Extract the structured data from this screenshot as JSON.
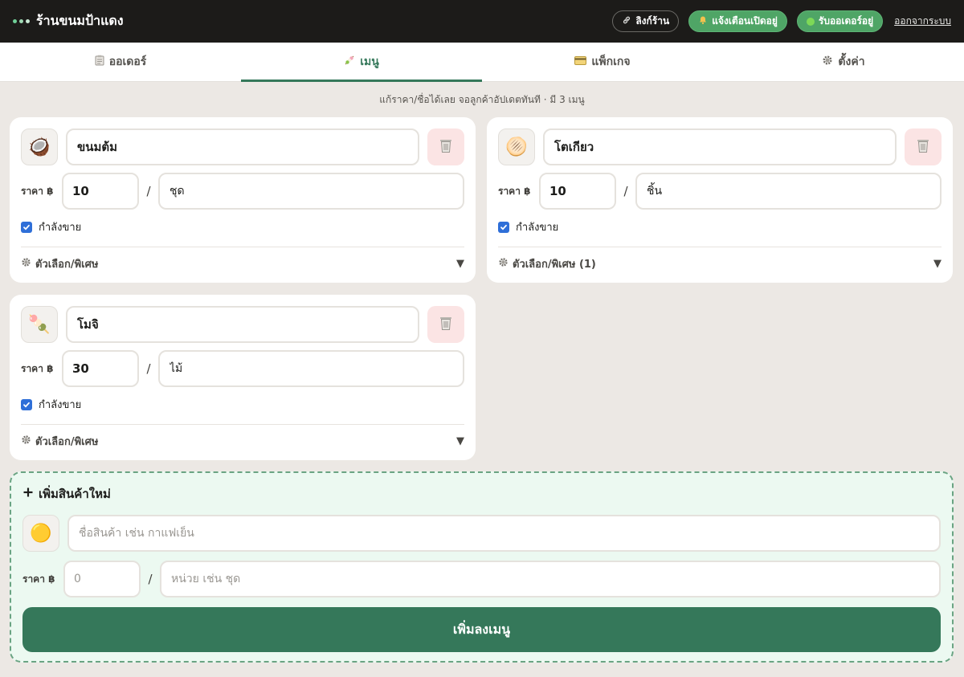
{
  "header": {
    "title": "ร้านขนมป้าแดง",
    "shop_link_label": "ลิงก์ร้าน",
    "notify_label": "แจ้งเตือนเปิดอยู่",
    "accepting_label": "รับออเดอร์อยู่",
    "logout_label": "ออกจากระบบ"
  },
  "tabs": [
    {
      "label": "ออเดอร์",
      "icon": "clipboard-icon"
    },
    {
      "label": "เมนู",
      "icon": "dango-icon"
    },
    {
      "label": "แพ็กเกจ",
      "icon": "card-icon"
    },
    {
      "label": "ตั้งค่า",
      "icon": "gear-icon"
    }
  ],
  "active_tab": 1,
  "subtitle": "แก้ราคา/ชื่อได้เลย จอลูกค้าอัปเดตทันที · มี 3 เมนู",
  "price_label": "ราคา ฿",
  "menu": [
    {
      "emoji": "🥥",
      "icon": "coconut-icon",
      "name": "ขนมต้ม",
      "price": "10",
      "unit": "ชุด",
      "selling_label": "กำลังขาย",
      "options_label": "ตัวเลือก/พิเศษ"
    },
    {
      "emoji": "🫓",
      "icon": "flatbread-icon",
      "name": "โตเกียว",
      "price": "10",
      "unit": "ชิ้น",
      "selling_label": "กำลังขาย",
      "options_label": "ตัวเลือก/พิเศษ (1)"
    },
    {
      "emoji": "🍡",
      "icon": "dango-icon",
      "name": "โมจิ",
      "price": "30",
      "unit": "ไม้",
      "selling_label": "กำลังขาย",
      "options_label": "ตัวเลือก/พิเศษ"
    }
  ],
  "add_new": {
    "title": "เพิ่มสินค้าใหม่",
    "emoji": "🟡",
    "name_placeholder": "ชื่อสินค้า เช่น กาแฟเย็น",
    "price_placeholder": "0",
    "unit_placeholder": "หน่วย เช่น ชุด",
    "submit_label": "เพิ่มลงเมนู"
  },
  "colors": {
    "primary": "#35785a",
    "header_bg": "#1c1b19",
    "delete_bg": "#fbe4e4",
    "checkbox": "#2f6fd8",
    "add_bg": "#ecf9f1"
  }
}
